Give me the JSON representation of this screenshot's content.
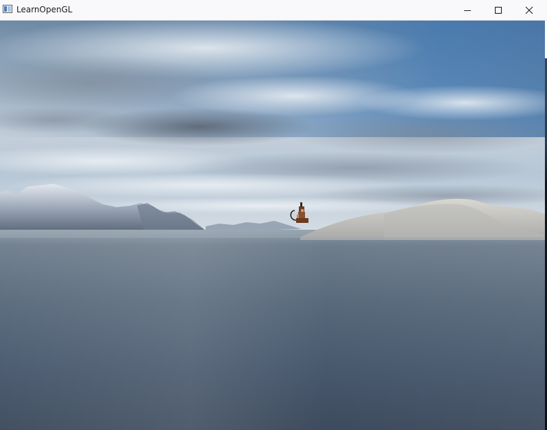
{
  "window": {
    "title": "LearnOpenGL",
    "icon": "app-window-icon",
    "controls": {
      "minimize_icon": "minimize-icon",
      "maximize_icon": "maximize-icon",
      "close_icon": "close-icon"
    }
  },
  "scene": {
    "description_icon": "opengl-skybox-render",
    "sky_color_top": "#3a6da3",
    "sky_color_mid": "#b9c8d8",
    "water_color": "#4a5968",
    "mountain_color": "#c9c7c0",
    "model": "nanosuit-model"
  }
}
